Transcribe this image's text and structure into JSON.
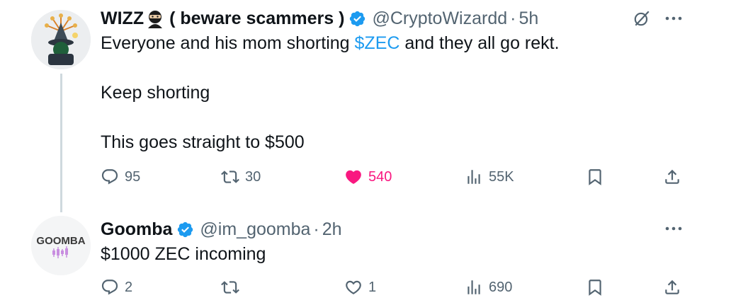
{
  "tweets": [
    {
      "display_name": "WIZZ",
      "name_suffix": "( beware scammers )",
      "handle": "@CryptoWizardd",
      "separator": "·",
      "time": "5h",
      "text_before_cashtag": "Everyone and his mom shorting ",
      "cashtag": "$ZEC",
      "text_after_cashtag": " and they all go rekt.",
      "line2": "Keep shorting",
      "line3": "This goes straight to $500",
      "replies": "95",
      "reposts": "30",
      "likes": "540",
      "views": "55K"
    },
    {
      "display_name": "Goomba",
      "handle": "@im_goomba",
      "separator": "·",
      "time": "2h",
      "text": "$1000 ZEC incoming",
      "replies": "2",
      "reposts": "",
      "likes": "1",
      "views": "690",
      "avatar_text": "GOOMBA"
    }
  ],
  "colors": {
    "accent": "#1d9bf0",
    "like": "#f91880",
    "muted": "#536471",
    "text": "#0f1419"
  },
  "icons": [
    "verified-badge-icon",
    "ninja-emoji-icon",
    "grok-icon",
    "more-icon",
    "reply-icon",
    "repost-icon",
    "like-icon",
    "views-icon",
    "bookmark-icon",
    "share-icon"
  ]
}
